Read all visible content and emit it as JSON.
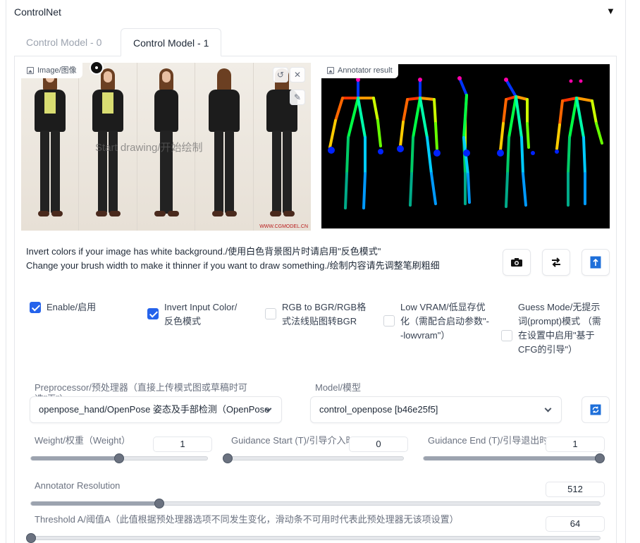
{
  "accordion": {
    "title": "ControlNet",
    "toggle_icon": "triangle-down-icon"
  },
  "tabs": [
    {
      "label": "Control Model - 0",
      "active": false
    },
    {
      "label": "Control Model - 1",
      "active": true
    }
  ],
  "image_input": {
    "label": "Image/图像",
    "draw_hint": "Start drawing/开始绘制",
    "watermark": "WWW.CGMODEL.CN"
  },
  "annotator": {
    "label": "Annotator result"
  },
  "hints": {
    "line1": "Invert colors if your image has white background./使用白色背景图片时请启用\"反色模式\"",
    "line2": "Change your brush width to make it thinner if you want to draw something./绘制内容请先调整笔刷粗细"
  },
  "tool_buttons": [
    {
      "icon": "camera-icon"
    },
    {
      "icon": "swap-arrows-icon"
    },
    {
      "icon": "upload-arrow-icon"
    }
  ],
  "checkboxes": {
    "enable": {
      "label": "Enable/启用",
      "checked": true
    },
    "invert": {
      "label": "Invert Input Color/反色模式",
      "checked": true
    },
    "rgb_bgr": {
      "label": "RGB to BGR/RGB格式法线贴图转BGR",
      "checked": false
    },
    "low_vram": {
      "label": "Low VRAM/低显存优化（需配合启动参数\"--lowvram\"）",
      "checked": false
    },
    "guess_mode": {
      "label": "Guess Mode/无提示词(prompt)模式 （需在设置中启用\"基于CFG的引导\"）",
      "checked": false
    }
  },
  "preprocessor": {
    "label": "Preprocessor/预处理器（直接上传模式图或草稿时可选\"无\"）",
    "value": "openpose_hand/OpenPose 姿态及手部检测（OpenPose"
  },
  "model": {
    "label": "Model/模型",
    "value": "control_openpose [b46e25f5]",
    "refresh_icon": "refresh-icon"
  },
  "sliders": {
    "weight": {
      "label": "Weight/权重（Weight）",
      "value": "1",
      "min": 0,
      "max": 2,
      "current": 1
    },
    "guidance_start": {
      "label": "Guidance Start (T)/引导介入时机",
      "value": "0",
      "min": 0,
      "max": 1,
      "current": 0
    },
    "guidance_end": {
      "label": "Guidance End (T)/引导退出时机",
      "value": "1",
      "min": 0,
      "max": 1,
      "current": 1
    },
    "annotator_resolution": {
      "label": "Annotator Resolution",
      "value": "512",
      "min": 64,
      "max": 2048,
      "current": 512
    },
    "threshold_a": {
      "label": "Threshold A/阈值A（此值根据预处理器选项不同发生变化，滑动条不可用时代表此预处理器无该项设置）",
      "value": "64",
      "min": 64,
      "max": 1024,
      "current": 64
    }
  }
}
